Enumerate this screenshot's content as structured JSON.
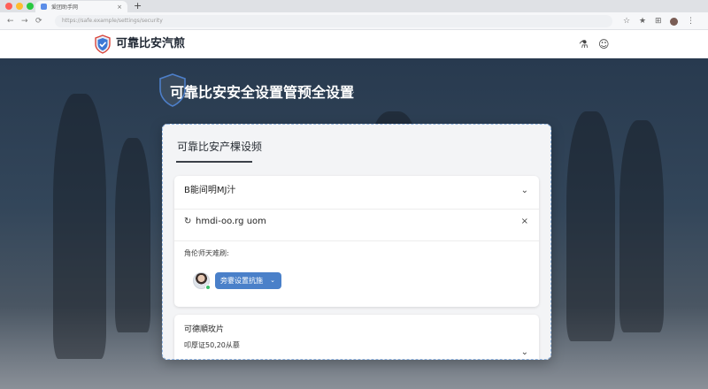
{
  "browser": {
    "tab_title": "爱团助手网",
    "new_tab": "+",
    "url": "https://safe.example/settings/security",
    "nav": {
      "back": "←",
      "forward": "→",
      "reload": "⟳"
    },
    "toolbar_icons": [
      "☆",
      "★",
      "⊞",
      "⋮"
    ]
  },
  "header": {
    "brand": "可靠比安汽煎",
    "icons": [
      "flask-icon",
      "bot-icon"
    ]
  },
  "hero": {
    "title": "可靠比安安全设置管预全设置",
    "chevron": "⌵"
  },
  "card": {
    "title": "可靠比安产棵设频",
    "panel1": {
      "row1_label": "B能间明MJ汁",
      "row1_chevron": "⌄",
      "row2_icon": "↻",
      "row2_value": "hmdi-oo.rg uom",
      "row2_close": "×",
      "row3_label": "角伦师天难刷:",
      "assign_pill": "旁霎设置抗施",
      "assign_chevron": "⌄"
    },
    "panel2": {
      "title": "可德順玫片",
      "subtitle": "叩厚证50,20从慕",
      "chevron": "⌄"
    }
  },
  "colors": {
    "accent": "#4a80c9",
    "hero_bg": "#2c3d52",
    "card_bg": "#f3f4f6"
  }
}
